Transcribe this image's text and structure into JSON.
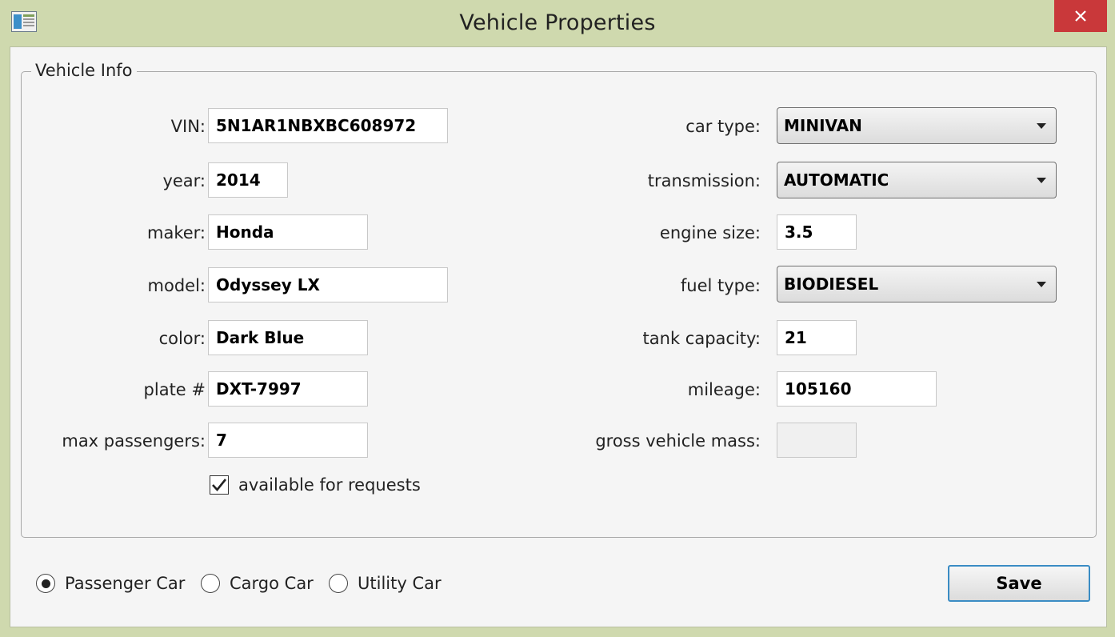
{
  "window": {
    "title": "Vehicle Properties",
    "icon": "app-window-icon",
    "close_icon": "close-icon"
  },
  "colors": {
    "frame": "#cfd9ae",
    "close": "#c9383a",
    "focus": "#3a8cc4"
  },
  "group": {
    "title": "Vehicle Info"
  },
  "left_fields": [
    {
      "label": "VIN:",
      "value": "5N1AR1NBXBC608972"
    },
    {
      "label": "year:",
      "value": "2014"
    },
    {
      "label": "maker:",
      "value": "Honda"
    },
    {
      "label": "model:",
      "value": "Odyssey LX"
    },
    {
      "label": "color:",
      "value": "Dark Blue"
    },
    {
      "label": "plate #",
      "value": "DXT-7997"
    },
    {
      "label": "max passengers:",
      "value": "7"
    }
  ],
  "right_fields": {
    "car_type": {
      "label": "car type:",
      "value": "MINIVAN"
    },
    "transmission": {
      "label": "transmission:",
      "value": "AUTOMATIC"
    },
    "engine_size": {
      "label": "engine size:",
      "value": "3.5"
    },
    "fuel_type": {
      "label": "fuel type:",
      "value": "BIODIESEL"
    },
    "tank_capacity": {
      "label": "tank capacity:",
      "value": "21"
    },
    "mileage": {
      "label": "mileage:",
      "value": "105160"
    },
    "gross_vehicle_mass": {
      "label": "gross vehicle mass:",
      "value": ""
    }
  },
  "available": {
    "label": "available for requests",
    "checked": true
  },
  "vehicle_kind": {
    "options": [
      "Passenger Car",
      "Cargo Car",
      "Utility Car"
    ],
    "selected": "Passenger Car"
  },
  "save_label": "Save"
}
